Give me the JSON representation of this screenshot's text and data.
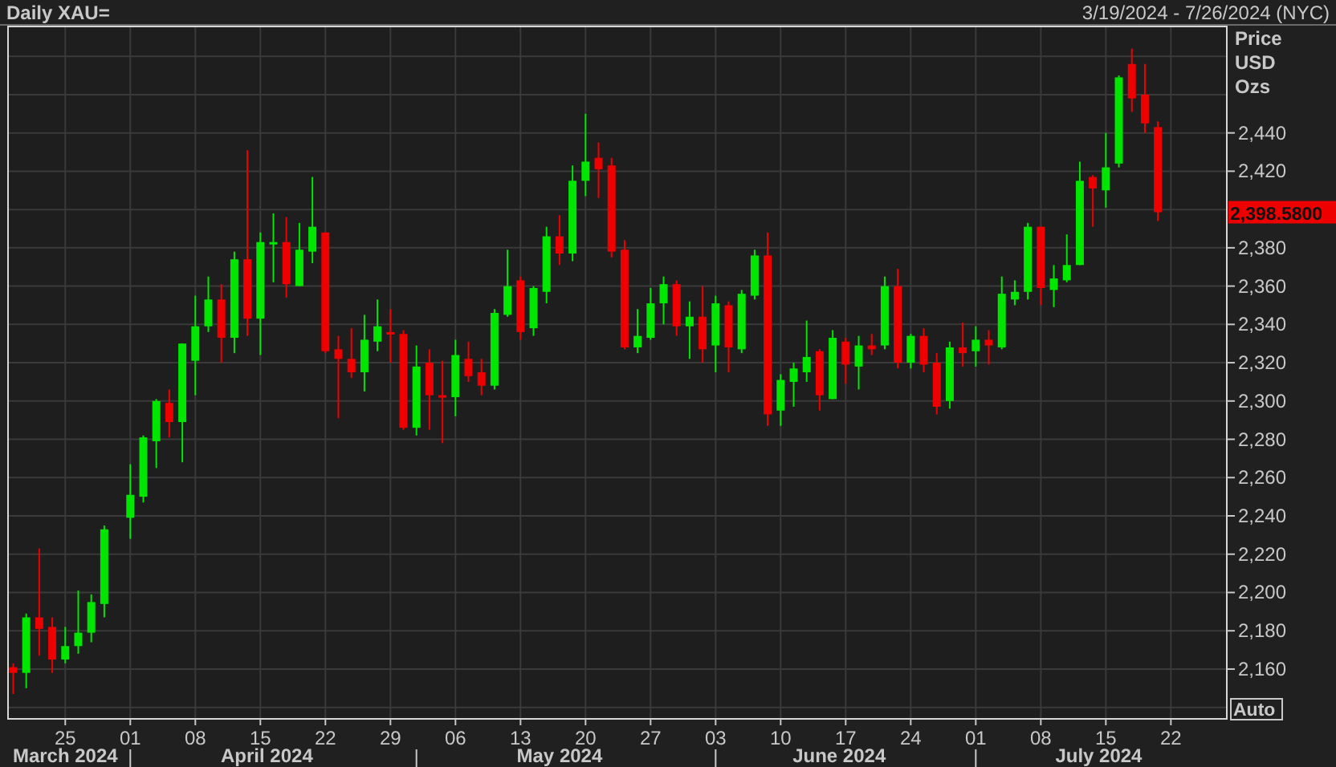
{
  "header": {
    "title": "Daily XAU=",
    "range": "3/19/2024 - 7/26/2024 (NYC)"
  },
  "chart": {
    "axis_heading": [
      "Price",
      "USD",
      "Ozs"
    ],
    "last_price": "2,398.5800",
    "auto_button": "Auto",
    "month_labels": [
      "March 2024",
      "April 2024",
      "May 2024",
      "June 2024",
      "July 2024"
    ],
    "chart_data": {
      "type": "candlestick",
      "grid": true,
      "ylim": [
        2134,
        2496
      ],
      "categories": [
        null,
        null,
        null,
        null,
        "25",
        null,
        null,
        null,
        null,
        "01",
        null,
        null,
        null,
        null,
        "08",
        null,
        null,
        null,
        null,
        "15",
        null,
        null,
        null,
        null,
        "22",
        null,
        null,
        null,
        null,
        "29",
        null,
        null,
        null,
        null,
        "06",
        null,
        null,
        null,
        null,
        "13",
        null,
        null,
        null,
        null,
        "20",
        null,
        null,
        null,
        null,
        "27",
        null,
        null,
        null,
        null,
        "03",
        null,
        null,
        null,
        null,
        "10",
        null,
        null,
        null,
        null,
        "17",
        null,
        null,
        null,
        null,
        "24",
        null,
        null,
        null,
        null,
        "01",
        null,
        null,
        null,
        null,
        "08",
        null,
        null,
        null,
        null,
        "15",
        null,
        null,
        null,
        null,
        "22"
      ],
      "ohlc": [
        [
          2161,
          2163,
          2147,
          2158
        ],
        [
          2158,
          2189,
          2150,
          2187
        ],
        [
          2187,
          2223,
          2167,
          2181
        ],
        [
          2182,
          2187,
          2158,
          2165
        ],
        [
          2165,
          2182,
          2163,
          2172
        ],
        [
          2172,
          2201,
          2168,
          2179
        ],
        [
          2179,
          2199,
          2174,
          2195
        ],
        [
          2194,
          2235,
          2187,
          2233
        ],
        null,
        [
          2239,
          2267,
          2228,
          2251
        ],
        [
          2250,
          2282,
          2247,
          2281
        ],
        [
          2279,
          2301,
          2265,
          2300
        ],
        [
          2299,
          2306,
          2281,
          2289
        ],
        [
          2289,
          2330,
          2268,
          2330
        ],
        [
          2321,
          2355,
          2303,
          2339
        ],
        [
          2339,
          2365,
          2336,
          2353
        ],
        [
          2353,
          2361,
          2320,
          2333
        ],
        [
          2333,
          2378,
          2325,
          2374
        ],
        [
          2374,
          2431,
          2334,
          2343
        ],
        [
          2343,
          2388,
          2324,
          2383
        ],
        [
          2382,
          2398,
          2362,
          2383
        ],
        [
          2383,
          2396,
          2354,
          2361
        ],
        [
          2360,
          2393,
          2360,
          2379
        ],
        [
          2378,
          2417,
          2372,
          2391
        ],
        [
          2388,
          2388,
          2325,
          2326
        ],
        [
          2327,
          2334,
          2291,
          2322
        ],
        [
          2322,
          2338,
          2312,
          2315
        ],
        [
          2315,
          2345,
          2305,
          2332
        ],
        [
          2331,
          2353,
          2326,
          2339
        ],
        [
          2336,
          2348,
          2320,
          2335
        ],
        [
          2335,
          2337,
          2285,
          2286
        ],
        [
          2286,
          2329,
          2282,
          2318
        ],
        [
          2320,
          2327,
          2285,
          2303
        ],
        [
          2303,
          2321,
          2278,
          2302
        ],
        [
          2302,
          2332,
          2292,
          2324
        ],
        [
          2322,
          2331,
          2310,
          2313
        ],
        [
          2315,
          2322,
          2303,
          2308
        ],
        [
          2308,
          2348,
          2306,
          2346
        ],
        [
          2345,
          2379,
          2344,
          2360
        ],
        [
          2363,
          2365,
          2332,
          2336
        ],
        [
          2338,
          2360,
          2334,
          2359
        ],
        [
          2357,
          2391,
          2351,
          2386
        ],
        [
          2386,
          2397,
          2371,
          2377
        ],
        [
          2377,
          2423,
          2373,
          2415
        ],
        [
          2415,
          2450,
          2407,
          2425
        ],
        [
          2427,
          2435,
          2406,
          2421
        ],
        [
          2423,
          2427,
          2375,
          2378
        ],
        [
          2379,
          2384,
          2327,
          2328
        ],
        [
          2328,
          2348,
          2325,
          2334
        ],
        [
          2333,
          2359,
          2332,
          2351
        ],
        [
          2351,
          2365,
          2340,
          2361
        ],
        [
          2361,
          2363,
          2334,
          2339
        ],
        [
          2339,
          2352,
          2322,
          2344
        ],
        [
          2344,
          2360,
          2320,
          2327
        ],
        [
          2329,
          2355,
          2315,
          2351
        ],
        [
          2350,
          2352,
          2315,
          2328
        ],
        [
          2327,
          2358,
          2325,
          2356
        ],
        [
          2355,
          2379,
          2353,
          2376
        ],
        [
          2376,
          2388,
          2287,
          2293
        ],
        [
          2295,
          2314,
          2287,
          2311
        ],
        [
          2310,
          2320,
          2297,
          2317
        ],
        [
          2315,
          2342,
          2310,
          2323
        ],
        [
          2326,
          2327,
          2295,
          2303
        ],
        [
          2301,
          2337,
          2301,
          2333
        ],
        [
          2331,
          2333,
          2309,
          2319
        ],
        [
          2318,
          2334,
          2306,
          2329
        ],
        [
          2329,
          2335,
          2324,
          2327
        ],
        [
          2329,
          2365,
          2327,
          2360
        ],
        [
          2360,
          2369,
          2317,
          2320
        ],
        [
          2320,
          2335,
          2317,
          2334
        ],
        [
          2334,
          2338,
          2315,
          2319
        ],
        [
          2320,
          2325,
          2293,
          2297
        ],
        [
          2300,
          2331,
          2296,
          2328
        ],
        [
          2328,
          2341,
          2318,
          2325
        ],
        [
          2326,
          2339,
          2318,
          2332
        ],
        [
          2332,
          2337,
          2319,
          2329
        ],
        [
          2328,
          2365,
          2327,
          2356
        ],
        [
          2353,
          2363,
          2350,
          2357
        ],
        [
          2357,
          2393,
          2353,
          2391
        ],
        [
          2391,
          2391,
          2350,
          2359
        ],
        [
          2358,
          2371,
          2349,
          2364
        ],
        [
          2363,
          2387,
          2362,
          2371
        ],
        [
          2371,
          2425,
          2371,
          2415
        ],
        [
          2417,
          2418,
          2391,
          2411
        ],
        [
          2410,
          2440,
          2401,
          2422
        ],
        [
          2424,
          2470,
          2422,
          2469
        ],
        [
          2476,
          2484,
          2451,
          2458
        ],
        [
          2460,
          2476,
          2440,
          2445
        ],
        [
          2443,
          2446,
          2394,
          2398.58
        ],
        null
      ],
      "yticks": [
        {
          "value": 2160,
          "label": "2,160"
        },
        {
          "value": 2180,
          "label": "2,180"
        },
        {
          "value": 2200,
          "label": "2,200"
        },
        {
          "value": 2220,
          "label": "2,220"
        },
        {
          "value": 2240,
          "label": "2,240"
        },
        {
          "value": 2260,
          "label": "2,260"
        },
        {
          "value": 2280,
          "label": "2,280"
        },
        {
          "value": 2300,
          "label": "2,300"
        },
        {
          "value": 2320,
          "label": "2,320"
        },
        {
          "value": 2340,
          "label": "2,340"
        },
        {
          "value": 2360,
          "label": "2,360"
        },
        {
          "value": 2380,
          "label": "2,380"
        },
        {
          "value": 2420,
          "label": "2,420"
        },
        {
          "value": 2440,
          "label": "2,440"
        }
      ]
    }
  }
}
